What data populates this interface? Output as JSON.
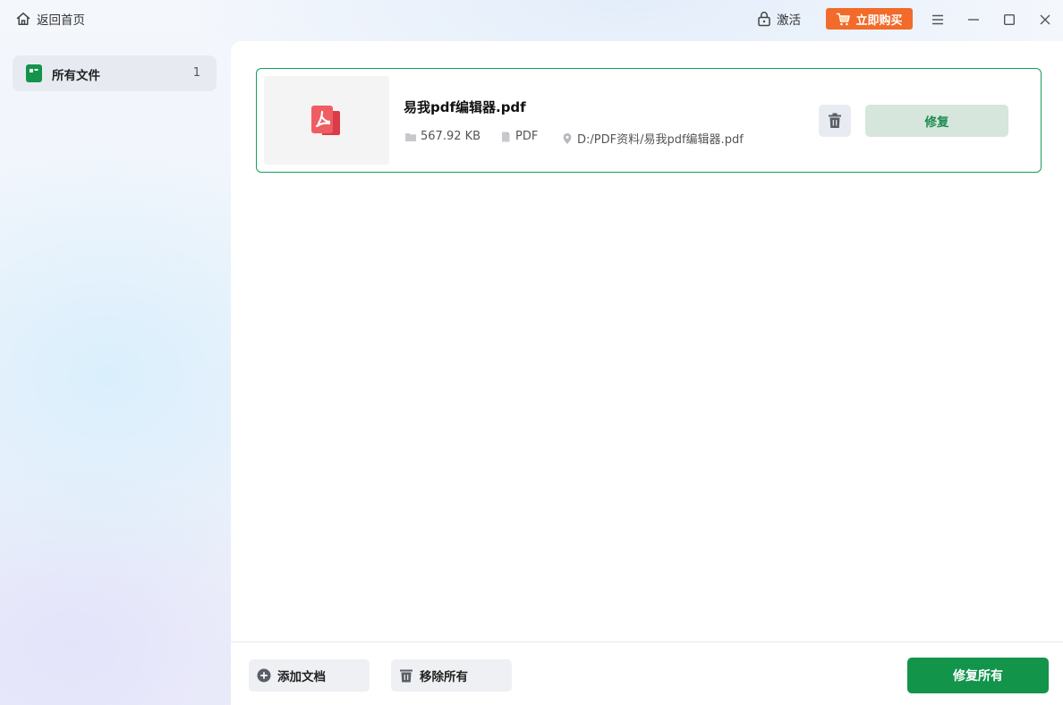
{
  "titlebar": {
    "home_label": "返回首页",
    "activate_label": "激活",
    "buy_label": "立即购买"
  },
  "sidebar": {
    "items": [
      {
        "label": "所有文件",
        "count": "1"
      }
    ]
  },
  "files": [
    {
      "name": "易我pdf编辑器.pdf",
      "size": "567.92 KB",
      "type": "PDF",
      "path": "D:/PDF资料/易我pdf编辑器.pdf",
      "repair_label": "修复"
    }
  ],
  "bottom": {
    "add_label": "添加文档",
    "remove_all_label": "移除所有",
    "repair_all_label": "修复所有"
  },
  "colors": {
    "accent_green": "#12944b",
    "buy_orange": "#f26b2a",
    "card_border": "#14a058"
  },
  "icons": [
    "home-icon",
    "lock-icon",
    "cart-icon",
    "menu-icon",
    "minimize-icon",
    "maximize-icon",
    "close-icon",
    "files-icon",
    "pdf-icon",
    "folder-icon",
    "file-type-icon",
    "location-icon",
    "trash-icon",
    "add-circle-icon"
  ]
}
